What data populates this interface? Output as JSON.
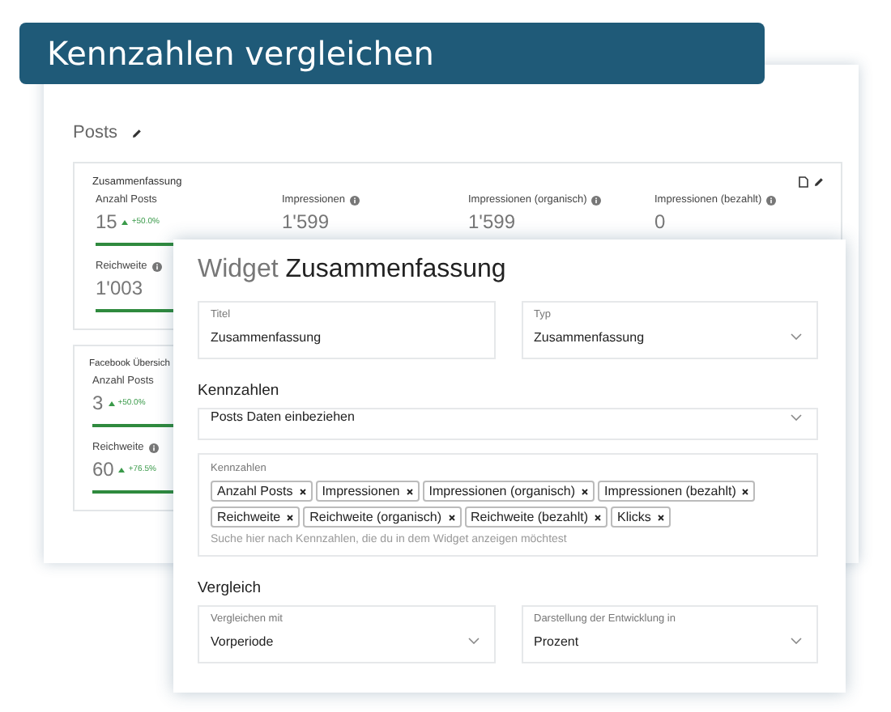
{
  "banner": {
    "title": "Kennzahlen vergleichen"
  },
  "dashboard": {
    "title": "Posts",
    "cards": [
      {
        "title": "Zusammenfassung",
        "kind": "summary",
        "metrics": [
          {
            "label": "Anzahl Posts",
            "info": false,
            "value": "15",
            "change": "+50.0%"
          },
          {
            "label": "Impressionen",
            "info": true,
            "value": "1'599"
          },
          {
            "label": "Impressionen (organisch)",
            "info": true,
            "value": "1'599"
          },
          {
            "label": "Impressionen (bezahlt)",
            "info": true,
            "value": "0"
          },
          {
            "label": "Reichweite",
            "info": true,
            "value": "1'003"
          }
        ]
      },
      {
        "title": "Facebook Übersich",
        "kind": "overview",
        "metrics": [
          {
            "label": "Anzahl Posts",
            "info": false,
            "value": "3",
            "change": "+50.0%"
          },
          {
            "label": "Reichweite",
            "info": true,
            "value": "60",
            "change": "+76.5%"
          }
        ]
      }
    ]
  },
  "modal": {
    "title_light": "Widget",
    "title_bold": "Zusammenfassung",
    "top_fields": [
      {
        "kind": "input",
        "label": "Titel",
        "value": "Zusammenfassung"
      },
      {
        "kind": "select",
        "label": "Typ",
        "value": "Zusammenfassung"
      }
    ],
    "metrics_section": {
      "heading": "Kennzahlen",
      "source": "Posts Daten einbeziehen",
      "tags_label": "Kennzahlen",
      "tags": [
        "Anzahl Posts",
        "Impressionen",
        "Impressionen (organisch)",
        "Impressionen (bezahlt)",
        "Reichweite",
        "Reichweite (organisch)",
        "Reichweite (bezahlt)",
        "Klicks"
      ],
      "placeholder": "Suche hier nach Kennzahlen, die du in dem Widget anzeigen möchtest"
    },
    "compare_section": {
      "heading": "Vergleich",
      "fields": [
        {
          "kind": "select",
          "label": "Vergleichen mit",
          "value": "Vorperiode"
        },
        {
          "kind": "select",
          "label": "Darstellung der Entwicklung in",
          "value": "Prozent"
        }
      ]
    }
  }
}
